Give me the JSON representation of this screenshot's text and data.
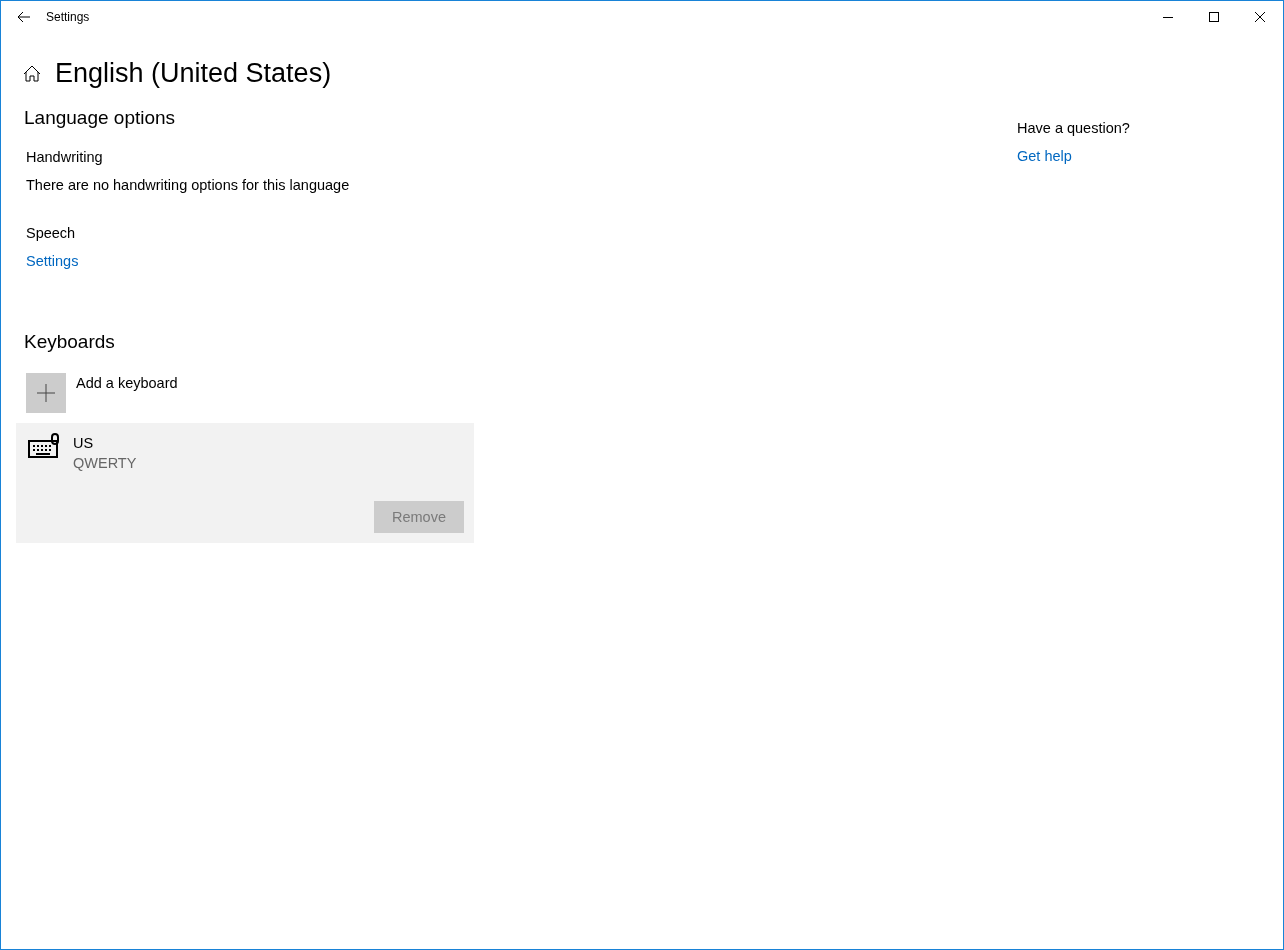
{
  "window": {
    "title": "Settings"
  },
  "page": {
    "title": "English (United States)"
  },
  "language_options": {
    "heading": "Language options",
    "handwriting": {
      "label": "Handwriting",
      "text": "There are no handwriting options for this language"
    },
    "speech": {
      "label": "Speech",
      "link": "Settings"
    }
  },
  "keyboards": {
    "heading": "Keyboards",
    "add_label": "Add a keyboard",
    "items": [
      {
        "name": "US",
        "layout": "QWERTY",
        "selected": true,
        "remove_button": {
          "label": "Remove",
          "disabled": true
        }
      }
    ]
  },
  "help": {
    "question": "Have a question?",
    "link": "Get help"
  }
}
